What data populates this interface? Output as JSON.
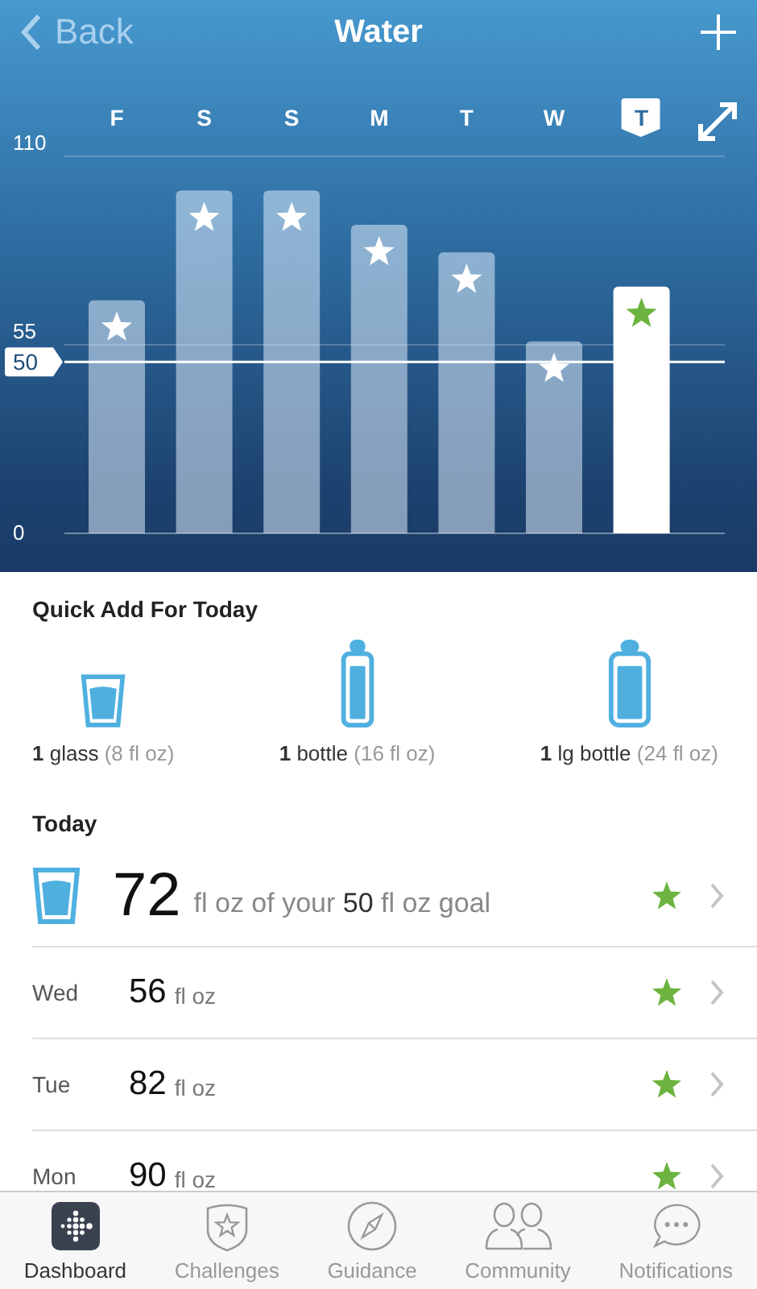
{
  "nav": {
    "back": "Back",
    "title": "Water"
  },
  "days": [
    {
      "selected": false
    },
    {
      "selected": false
    },
    {
      "selected": false
    },
    {
      "selected": false
    },
    {
      "selected": false
    },
    {
      "selected": false
    },
    {
      "selected": true
    }
  ],
  "chart_data": {
    "type": "bar",
    "categories": [
      "F",
      "S",
      "S",
      "M",
      "T",
      "W",
      "T"
    ],
    "values": [
      68,
      100,
      100,
      90,
      82,
      56,
      72
    ],
    "ylim": [
      0,
      110
    ],
    "yticks": [
      0,
      55,
      110
    ],
    "ref_lines": [
      {
        "axis": "y",
        "value": 50,
        "label": "50"
      }
    ]
  },
  "quick_add": {
    "title": "Quick Add For Today",
    "items": [
      {
        "kind": "glass",
        "label": "**1** glass",
        "size": "(8 fl oz)"
      },
      {
        "kind": "bottle",
        "label": "**1** bottle",
        "size": "(16 fl oz)"
      },
      {
        "kind": "large_bottle",
        "label": "**1** lg bottle",
        "size": "(24 fl oz)"
      }
    ]
  },
  "today": {
    "heading": "Today",
    "amount": "72",
    "text": "fl oz of your **50** fl oz goal",
    "goal_met": true
  },
  "history": [
    {
      "day": "Wed",
      "amount": "56",
      "unit": "fl oz",
      "goal_met": true
    },
    {
      "day": "Tue",
      "amount": "82",
      "unit": "fl oz",
      "goal_met": true
    },
    {
      "day": "Mon",
      "amount": "90",
      "unit": "fl oz",
      "goal_met": true
    }
  ],
  "tabs": [
    {
      "kind": "dashboard",
      "label": "Dashboard",
      "selected": true
    },
    {
      "kind": "challenges",
      "label": "Challenges",
      "selected": false
    },
    {
      "kind": "guidance",
      "label": "Guidance",
      "selected": false
    },
    {
      "kind": "community",
      "label": "Community",
      "selected": false
    },
    {
      "kind": "notifications",
      "label": "Notifications",
      "selected": false
    }
  ]
}
